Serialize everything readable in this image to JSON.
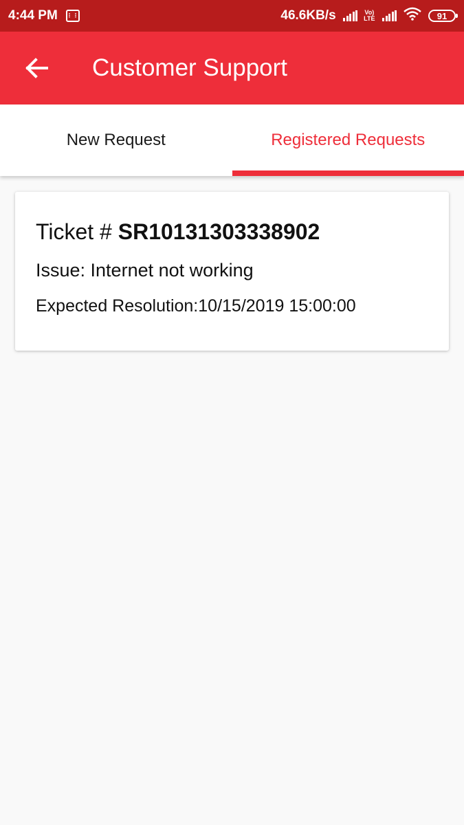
{
  "status_bar": {
    "time": "4:44 PM",
    "network_speed": "46.6KB/s",
    "volte_line1": "Vo)",
    "volte_line2": "LTE",
    "battery": "91"
  },
  "app_bar": {
    "title": "Customer Support",
    "back_icon": "arrow-left-icon"
  },
  "tabs": [
    {
      "label": "New Request",
      "active": false
    },
    {
      "label": "Registered Requests",
      "active": true
    }
  ],
  "ticket": {
    "prefix": "Ticket # ",
    "id": "SR10131303338902",
    "issue": "Issue: Internet not working",
    "expected_resolution": "Expected Resolution:10/15/2019 15:00:00"
  },
  "colors": {
    "status_bar": "#b71c1c",
    "accent": "#ee2e3a",
    "background": "#f9f9f9"
  }
}
